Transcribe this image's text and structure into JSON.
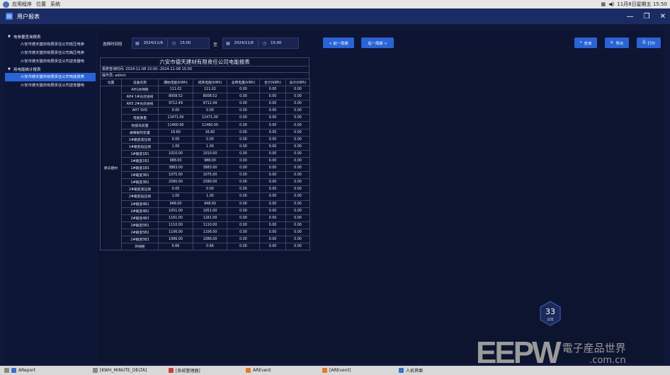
{
  "system_bar": {
    "menus": [
      "应用程序",
      "位置",
      "系统"
    ],
    "clock": "11月8日星期五 15:50"
  },
  "window": {
    "title": "用户报表"
  },
  "sidebar": {
    "groups": [
      {
        "label": "电参量查询报表",
        "items": [
          "六安市德天建材有限责任公司低压电参",
          "六安市德天建材有限责任公司高压电参",
          "六安市德天建材有限责任公司逆变器电"
        ]
      },
      {
        "label": "用电能统计报表",
        "items": [
          "六安市德天建材有限责任公司电能报表",
          "六安市德天建材有限责任公司逆变器电"
        ]
      }
    ]
  },
  "filter": {
    "label": "选择时间段",
    "start_date": "2024/11/8",
    "start_time": "15:00",
    "to": "至",
    "end_date": "2024/11/8",
    "end_time": "15:00",
    "prev_btn": "< 前一周期",
    "next_btn": "后一周期 >",
    "query_btn": "查询",
    "export_btn": "导出",
    "print_btn": "打印"
  },
  "report": {
    "title": "六安市德天建材有限责任公司电能报表",
    "meta_time": "报表查询时间: 2024-11-08 15:00--2024-11-08 15:00",
    "meta_operator": "操作员: admin",
    "headers": [
      "位置",
      "设备名称",
      "期始电能(kWh)",
      "结束电能(kWh)",
      "总用电量(kWh)",
      "合计(kWh)",
      "总计(kWh)"
    ],
    "location": "德天建材",
    "rows": [
      [
        "AH1并网柜",
        "111.02",
        "111.02",
        "0.00",
        "0.00",
        "0.00"
      ],
      [
        "AH4 1#光伏进线",
        "8008.52",
        "8008.52",
        "0.00",
        "0.00",
        "0.00"
      ],
      [
        "AH5 2#光伏进线",
        "9712.49",
        "9712.49",
        "0.00",
        "0.00",
        "0.00"
      ],
      [
        "AH7 SVG",
        "0.00",
        "0.00",
        "0.00",
        "0.00",
        "0.00"
      ],
      [
        "电能质量",
        "11471.00",
        "11471.00",
        "0.00",
        "0.00",
        "0.00"
      ],
      [
        "防孤岛装置",
        "11460.00",
        "11460.00",
        "0.00",
        "0.00",
        "0.00"
      ],
      [
        "故障解列装置",
        "16.60",
        "16.60",
        "0.00",
        "0.00",
        "0.00"
      ],
      [
        "1#箱变高压侧",
        "0.00",
        "0.00",
        "0.00",
        "0.00",
        "0.00"
      ],
      [
        "1#箱变低压侧",
        "1.00",
        "1.00",
        "0.00",
        "0.00",
        "0.00"
      ],
      [
        "1#箱变1B1",
        "1010.00",
        "1010.00",
        "0.00",
        "0.00",
        "0.00"
      ],
      [
        "1#箱变1B2",
        "988.00",
        "988.00",
        "0.00",
        "0.00",
        "0.00"
      ],
      [
        "1#箱变1B3",
        "3883.00",
        "3883.00",
        "0.00",
        "0.00",
        "0.00"
      ],
      [
        "1#箱变3B1",
        "1075.00",
        "1075.00",
        "0.00",
        "0.00",
        "0.00"
      ],
      [
        "1#箱变3B2",
        "2580.00",
        "2580.00",
        "0.00",
        "0.00",
        "0.00"
      ],
      [
        "2#箱变高压侧",
        "0.00",
        "0.00",
        "0.00",
        "0.00",
        "0.00"
      ],
      [
        "2#箱变低压侧",
        "1.00",
        "1.00",
        "0.00",
        "0.00",
        "0.00"
      ],
      [
        "2#箱变4B1",
        "948.00",
        "948.00",
        "0.00",
        "0.00",
        "0.00"
      ],
      [
        "2#箱变4B2",
        "1051.00",
        "1051.00",
        "0.00",
        "0.00",
        "0.00"
      ],
      [
        "2#箱变4B3",
        "1161.00",
        "1161.00",
        "0.00",
        "0.00",
        "0.00"
      ],
      [
        "2#箱变5B1",
        "1110.00",
        "1110.00",
        "0.00",
        "0.00",
        "0.00"
      ],
      [
        "2#箱变5B2",
        "1106.00",
        "1106.00",
        "0.00",
        "0.00",
        "0.00"
      ],
      [
        "2#箱变5B3",
        "1086.00",
        "1086.00",
        "0.00",
        "0.00",
        "0.00"
      ],
      [
        "环网柜",
        "0.66",
        "0.66",
        "0.00",
        "0.00",
        "0.00"
      ]
    ]
  },
  "badge": {
    "count": "33",
    "label": "异常"
  },
  "watermark": {
    "logo": "EEPW",
    "cn": "電子産品世界",
    "domain": ".com.cn"
  },
  "taskbar": {
    "items": [
      "AReport",
      "[KWH_MINUTE_DELTA]",
      "[系统管理器]",
      "AREvent",
      "[AREvent]",
      "人机界面"
    ]
  }
}
